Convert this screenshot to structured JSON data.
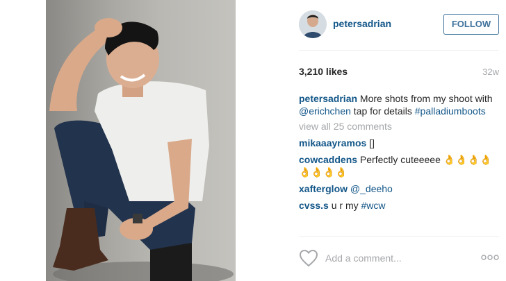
{
  "post": {
    "username": "petersadrian",
    "follow_label": "FOLLOW",
    "likes": "3,210 likes",
    "age": "32w",
    "caption": {
      "username": "petersadrian",
      "text_before": " More shots from my shoot with ",
      "mention": "@erichchen",
      "text_after": " tap for details ",
      "hashtag": "#palladiumboots"
    },
    "view_all": "view all 25 comments",
    "comments": [
      {
        "username": "mikaaayramos",
        "text": " []"
      },
      {
        "username": "cowcaddens",
        "text": " Perfectly cuteeeee 👌👌👌👌👌👌👌👌"
      },
      {
        "username": "xafterglow",
        "mention": " @_deeho"
      },
      {
        "username": "cvss.s",
        "text": " u r my ",
        "hashtag": "#wcw"
      }
    ],
    "add_comment_placeholder": "Add a comment...",
    "icons": {
      "like": "heart-icon",
      "more": "more-options-icon"
    },
    "colors": {
      "link": "#125688",
      "follow": "#3f729b",
      "muted": "#a5a7aa"
    }
  }
}
